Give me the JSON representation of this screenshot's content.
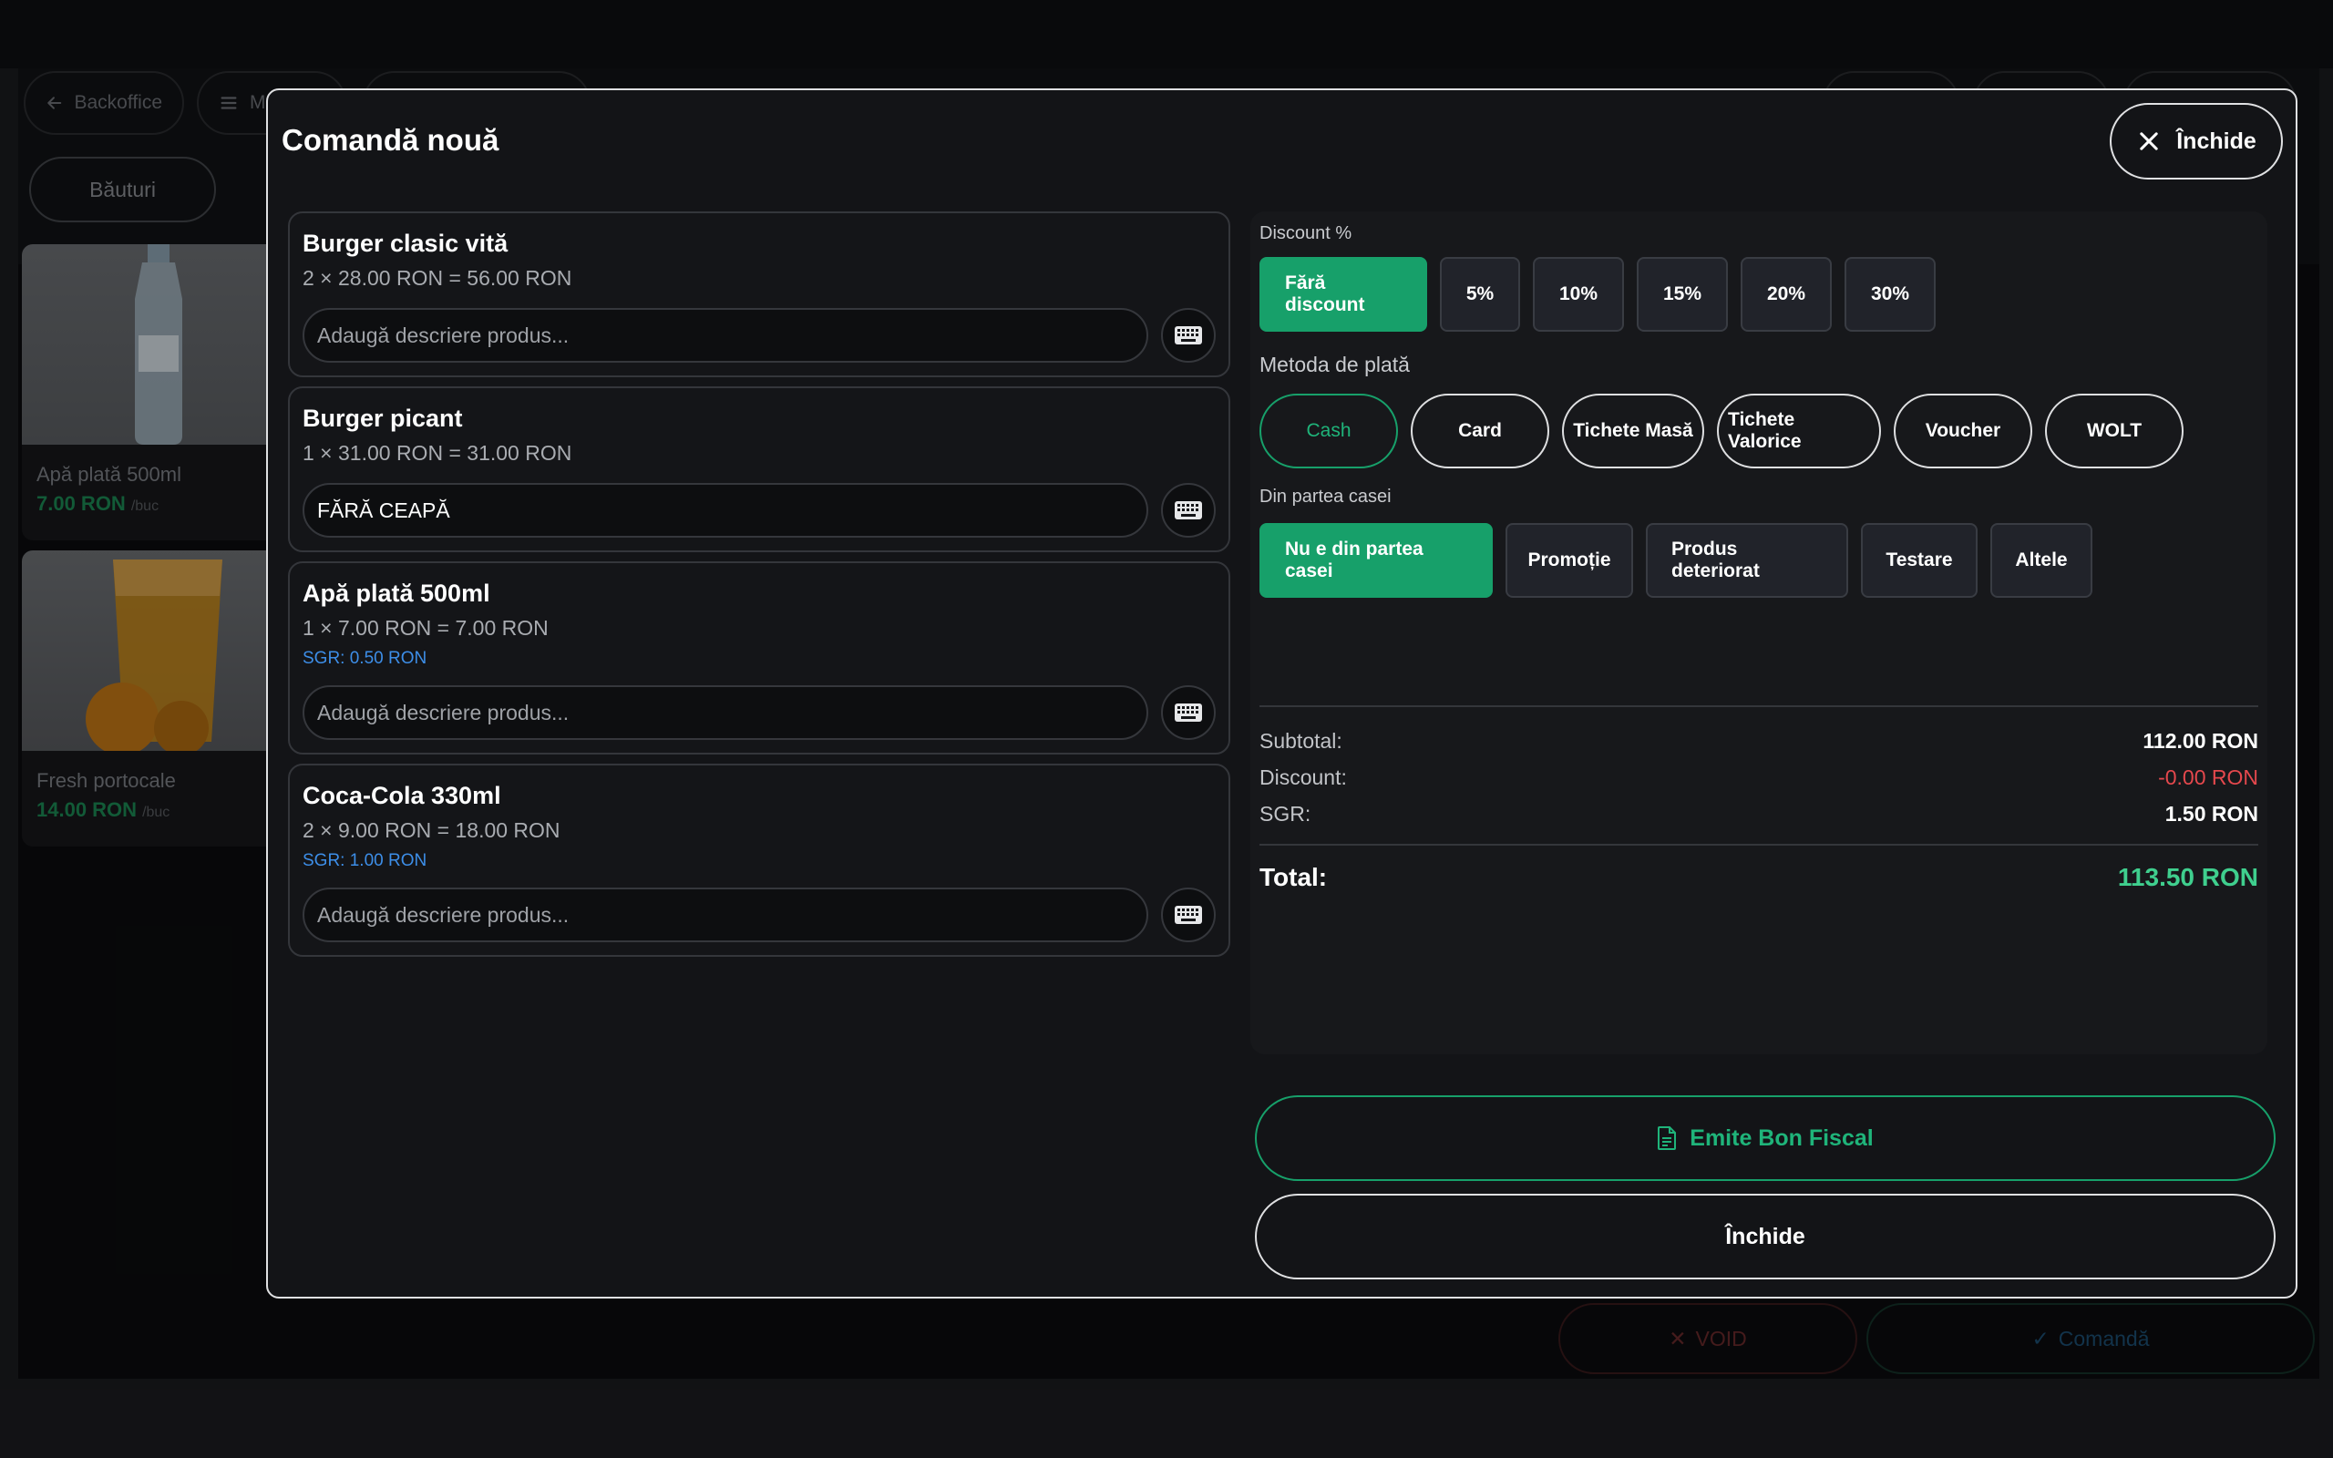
{
  "background": {
    "back_button": "Backoffice",
    "menu_button": "M",
    "category": "Băuturi",
    "products": [
      {
        "name": "Apă plată 500ml",
        "price": "7.00 RON",
        "unit": "/buc"
      },
      {
        "name": "Fresh portocale",
        "price": "14.00 RON",
        "unit": "/buc"
      }
    ],
    "void_button": "VOID",
    "order_button": "Comandă"
  },
  "modal": {
    "title": "Comandă nouă",
    "close_label": "Închide",
    "description_placeholder": "Adaugă descriere produs...",
    "items": [
      {
        "name": "Burger clasic vită",
        "calc": "2 × 28.00 RON = 56.00 RON",
        "sgr": "",
        "description": ""
      },
      {
        "name": "Burger picant",
        "calc": "1 × 31.00 RON = 31.00 RON",
        "sgr": "",
        "description": "FĂRĂ CEAPĂ"
      },
      {
        "name": "Apă plată 500ml",
        "calc": "1 × 7.00 RON = 7.00 RON",
        "sgr": "SGR: 0.50 RON",
        "description": ""
      },
      {
        "name": "Coca-Cola 330ml",
        "calc": "2 × 9.00 RON = 18.00 RON",
        "sgr": "SGR: 1.00 RON",
        "description": ""
      }
    ],
    "discount": {
      "label": "Discount %",
      "options": [
        "Fără discount",
        "5%",
        "10%",
        "15%",
        "20%",
        "30%"
      ],
      "selected": "Fără discount"
    },
    "payment": {
      "label": "Metoda de plată",
      "options": [
        "Cash",
        "Card",
        "Tichete Masă",
        "Tichete Valorice",
        "Voucher",
        "WOLT"
      ],
      "selected": "Cash"
    },
    "house": {
      "label": "Din partea casei",
      "options": [
        "Nu e din partea casei",
        "Promoție",
        "Produs deteriorat",
        "Testare",
        "Altele"
      ],
      "selected": "Nu e din partea casei"
    },
    "summary": {
      "subtotal_label": "Subtotal:",
      "subtotal_value": "112.00 RON",
      "discount_label": "Discount:",
      "discount_value": "-0.00 RON",
      "sgr_label": "SGR:",
      "sgr_value": "1.50 RON",
      "total_label": "Total:",
      "total_value": "113.50 RON"
    },
    "fiscal_button": "Emite Bon Fiscal",
    "close_bottom": "Închide"
  },
  "colors": {
    "accent_green": "#17a06a",
    "sgr_blue": "#3d8ee8",
    "discount_red": "#e5484d",
    "total_green": "#3fcf8e"
  }
}
